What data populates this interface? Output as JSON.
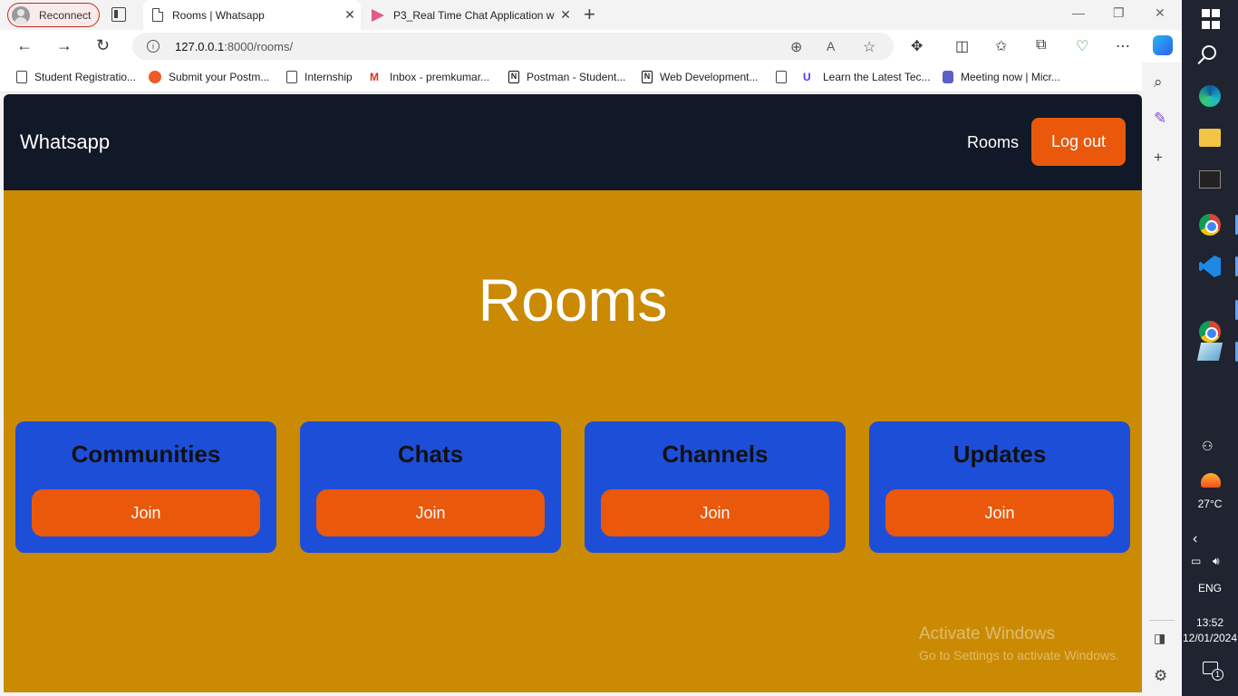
{
  "browser": {
    "profile_label": "Reconnect",
    "tabs": [
      {
        "title": "Rooms | Whatsapp",
        "active": true
      },
      {
        "title": "P3_Real Time Chat Application w",
        "active": false
      }
    ],
    "url_host": "127.0.0.1",
    "url_path": ":8000/rooms/",
    "bookmarks": [
      {
        "label": "Student Registratio...",
        "icon": "page-icon"
      },
      {
        "label": "Submit your Postm...",
        "icon": "postman-icon"
      },
      {
        "label": "Internship",
        "icon": "page-icon"
      },
      {
        "label": "Inbox - premkumar...",
        "icon": "gmail-icon"
      },
      {
        "label": "Postman - Student...",
        "icon": "notion-icon"
      },
      {
        "label": "Web Development...",
        "icon": "notion-icon"
      },
      {
        "label": "",
        "icon": "page-icon"
      },
      {
        "label": "Learn the Latest Tec...",
        "icon": "udemy-icon"
      },
      {
        "label": "Meeting now | Micr...",
        "icon": "teams-icon"
      }
    ]
  },
  "app": {
    "brand": "Whatsapp",
    "nav_rooms": "Rooms",
    "logout_label": "Log out",
    "page_title": "Rooms",
    "rooms": [
      {
        "name": "Communities",
        "button": "Join"
      },
      {
        "name": "Chats",
        "button": "Join"
      },
      {
        "name": "Channels",
        "button": "Join"
      },
      {
        "name": "Updates",
        "button": "Join"
      }
    ],
    "colors": {
      "header_bg": "#111827",
      "page_bg": "#ca8a04",
      "card_bg": "#1d4ed8",
      "button_bg": "#ea580c"
    }
  },
  "watermark": {
    "line1": "Activate Windows",
    "line2": "Go to Settings to activate Windows."
  },
  "taskbar": {
    "temperature": "27°C",
    "language": "ENG",
    "time": "13:52",
    "date": "12/01/2024",
    "notification_count": "1"
  }
}
